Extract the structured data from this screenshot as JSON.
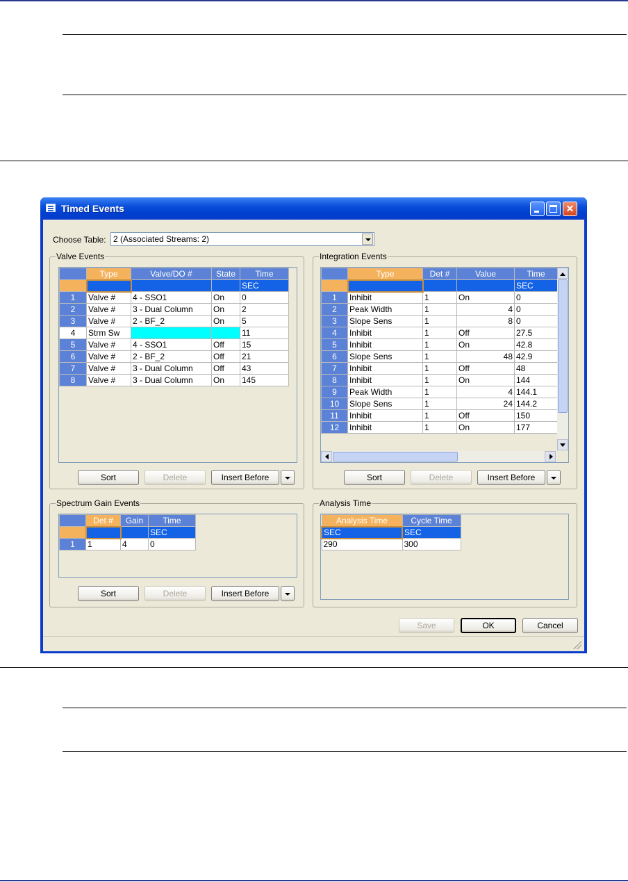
{
  "window": {
    "title": "Timed Events"
  },
  "choose_table": {
    "label": "Choose Table:",
    "value": "2 (Associated Streams: 2)"
  },
  "valve_events": {
    "title": "Valve Events",
    "columns": [
      "Type",
      "Valve/DO #",
      "State",
      "Time"
    ],
    "unit_row": [
      "",
      "",
      "",
      "SEC"
    ],
    "rows": [
      {
        "n": "1",
        "type": "Valve #",
        "valve": "4 - SSO1",
        "state": "On",
        "time": "0"
      },
      {
        "n": "2",
        "type": "Valve #",
        "valve": "3 - Dual Column",
        "state": "On",
        "time": "2"
      },
      {
        "n": "3",
        "type": "Valve #",
        "valve": "2 - BF_2",
        "state": "On",
        "time": "5"
      },
      {
        "n": "4",
        "type": "Strm Sw",
        "valve": "",
        "state": "",
        "time": "11"
      },
      {
        "n": "5",
        "type": "Valve #",
        "valve": "4 - SSO1",
        "state": "Off",
        "time": "15"
      },
      {
        "n": "6",
        "type": "Valve #",
        "valve": "2 - BF_2",
        "state": "Off",
        "time": "21"
      },
      {
        "n": "7",
        "type": "Valve #",
        "valve": "3 - Dual Column",
        "state": "Off",
        "time": "43"
      },
      {
        "n": "8",
        "type": "Valve #",
        "valve": "3 - Dual Column",
        "state": "On",
        "time": "145"
      }
    ],
    "buttons": {
      "sort": "Sort",
      "delete": "Delete",
      "insert": "Insert Before"
    }
  },
  "integration_events": {
    "title": "Integration Events",
    "columns": [
      "Type",
      "Det #",
      "Value",
      "Time"
    ],
    "unit_row": [
      "",
      "",
      "",
      "SEC"
    ],
    "rows": [
      {
        "n": "1",
        "type": "Inhibit",
        "det": "1",
        "value": "On",
        "time": "0"
      },
      {
        "n": "2",
        "type": "Peak Width",
        "det": "1",
        "value": "4",
        "time": "0"
      },
      {
        "n": "3",
        "type": "Slope Sens",
        "det": "1",
        "value": "8",
        "time": "0"
      },
      {
        "n": "4",
        "type": "Inhibit",
        "det": "1",
        "value": "Off",
        "time": "27.5"
      },
      {
        "n": "5",
        "type": "Inhibit",
        "det": "1",
        "value": "On",
        "time": "42.8"
      },
      {
        "n": "6",
        "type": "Slope Sens",
        "det": "1",
        "value": "48",
        "time": "42.9"
      },
      {
        "n": "7",
        "type": "Inhibit",
        "det": "1",
        "value": "Off",
        "time": "48"
      },
      {
        "n": "8",
        "type": "Inhibit",
        "det": "1",
        "value": "On",
        "time": "144"
      },
      {
        "n": "9",
        "type": "Peak Width",
        "det": "1",
        "value": "4",
        "time": "144.1"
      },
      {
        "n": "10",
        "type": "Slope Sens",
        "det": "1",
        "value": "24",
        "time": "144.2"
      },
      {
        "n": "11",
        "type": "Inhibit",
        "det": "1",
        "value": "Off",
        "time": "150"
      },
      {
        "n": "12",
        "type": "Inhibit",
        "det": "1",
        "value": "On",
        "time": "177"
      }
    ],
    "buttons": {
      "sort": "Sort",
      "delete": "Delete",
      "insert": "Insert Before"
    }
  },
  "spectrum_gain_events": {
    "title": "Spectrum Gain Events",
    "columns": [
      "Det #",
      "Gain",
      "Time"
    ],
    "unit_row": [
      "",
      "",
      "SEC"
    ],
    "rows": [
      {
        "n": "1",
        "det": "1",
        "gain": "4",
        "time": "0"
      }
    ],
    "buttons": {
      "sort": "Sort",
      "delete": "Delete",
      "insert": "Insert Before"
    }
  },
  "analysis_time": {
    "title": "Analysis Time",
    "columns": [
      "Analysis Time",
      "Cycle Time"
    ],
    "unit_row": [
      "SEC",
      "SEC"
    ],
    "values": [
      "290",
      "300"
    ]
  },
  "footer": {
    "save": "Save",
    "ok": "OK",
    "cancel": "Cancel"
  },
  "colors": {
    "header": "#5b82d7",
    "selected_header": "#f5b25d",
    "unit_row": "#1463e6",
    "title_bar": "#0a4fd9",
    "highlight": "#00ffff"
  }
}
